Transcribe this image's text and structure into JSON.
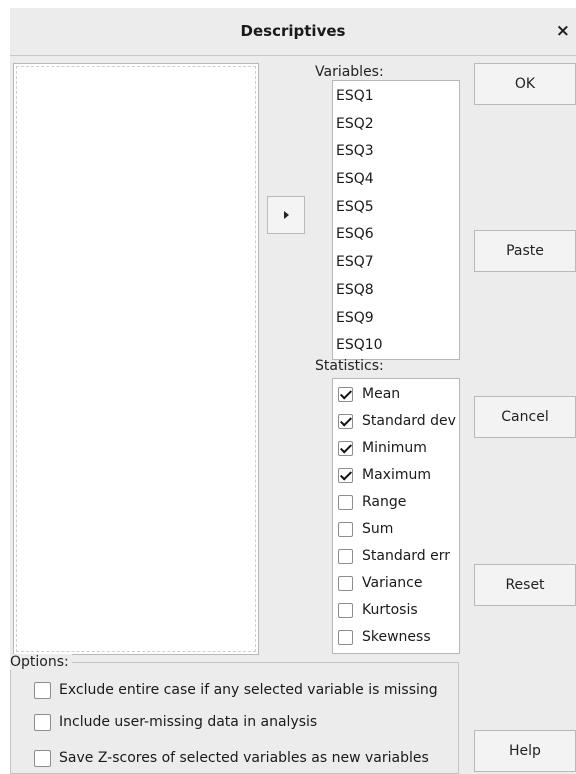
{
  "window": {
    "title": "Descriptives",
    "close_glyph": "×"
  },
  "variables": {
    "label": "Variables:",
    "items": [
      "ESQ1",
      "ESQ2",
      "ESQ3",
      "ESQ4",
      "ESQ5",
      "ESQ6",
      "ESQ7",
      "ESQ8",
      "ESQ9",
      "ESQ10"
    ]
  },
  "statistics": {
    "label": "Statistics:",
    "items": [
      {
        "label": "Mean",
        "checked": true
      },
      {
        "label": "Standard dev",
        "checked": true
      },
      {
        "label": "Minimum",
        "checked": true
      },
      {
        "label": "Maximum",
        "checked": true
      },
      {
        "label": "Range",
        "checked": false
      },
      {
        "label": "Sum",
        "checked": false
      },
      {
        "label": "Standard err",
        "checked": false
      },
      {
        "label": "Variance",
        "checked": false
      },
      {
        "label": "Kurtosis",
        "checked": false
      },
      {
        "label": "Skewness",
        "checked": false
      }
    ]
  },
  "buttons": {
    "ok": "OK",
    "paste": "Paste",
    "cancel": "Cancel",
    "reset": "Reset",
    "help": "Help"
  },
  "options": {
    "label": "Options:",
    "items": [
      {
        "label": "Exclude entire case if any selected variable is missing",
        "checked": false
      },
      {
        "label": "Include user-missing data in analysis",
        "checked": false
      },
      {
        "label": "Save Z-scores of selected variables as new variables",
        "checked": false
      }
    ]
  },
  "icons": {
    "move": "triangle-right-icon"
  }
}
